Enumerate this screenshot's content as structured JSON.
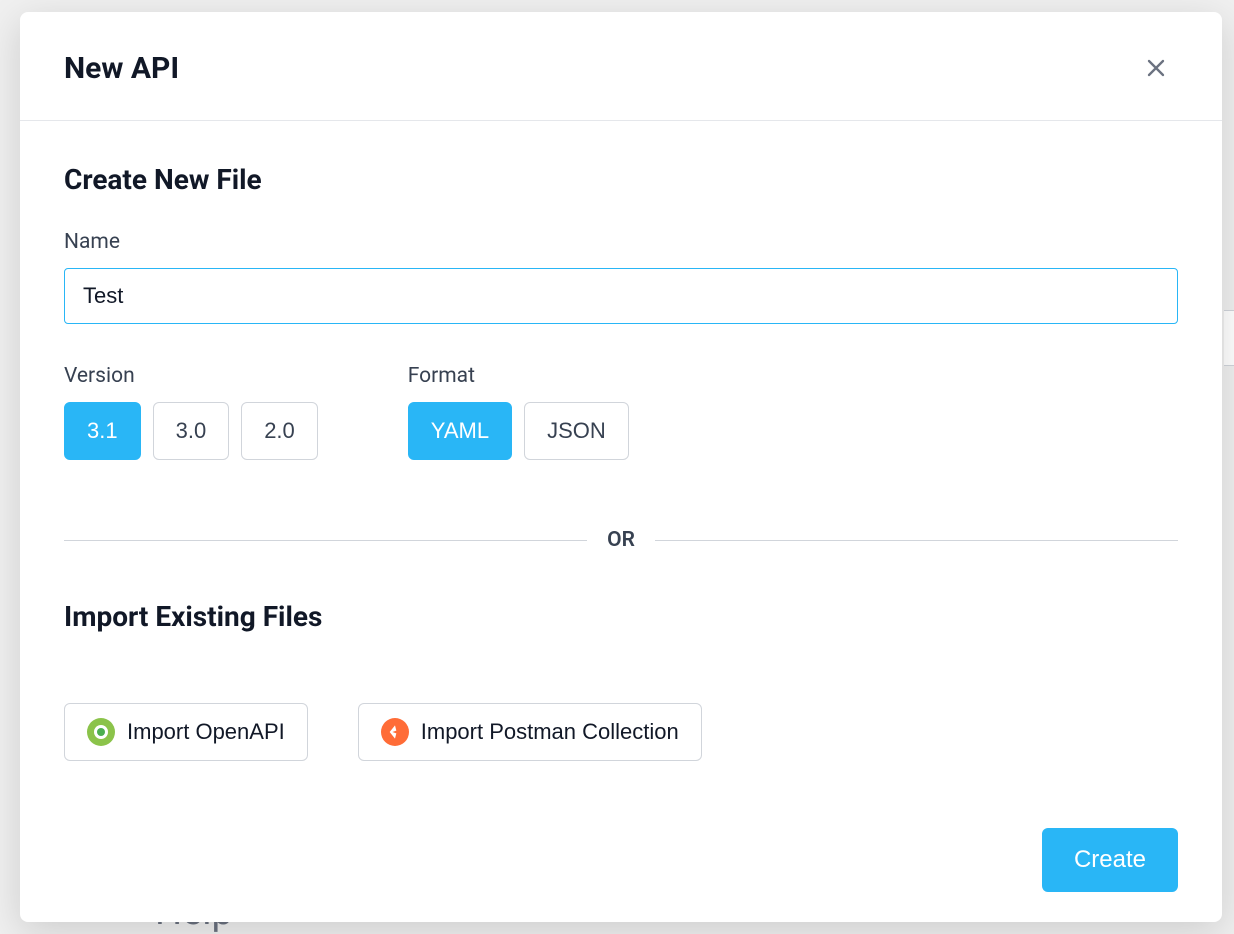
{
  "modal": {
    "title": "New API",
    "createSection": {
      "title": "Create New File",
      "nameLabel": "Name",
      "nameValue": "Test",
      "versionLabel": "Version",
      "versions": [
        "3.1",
        "3.0",
        "2.0"
      ],
      "selectedVersion": "3.1",
      "formatLabel": "Format",
      "formats": [
        "YAML",
        "JSON"
      ],
      "selectedFormat": "YAML"
    },
    "dividerText": "OR",
    "importSection": {
      "title": "Import Existing Files",
      "importOpenApiLabel": "Import OpenAPI",
      "importPostmanLabel": "Import Postman Collection"
    },
    "createButton": "Create"
  },
  "backdropLabel": "Help"
}
